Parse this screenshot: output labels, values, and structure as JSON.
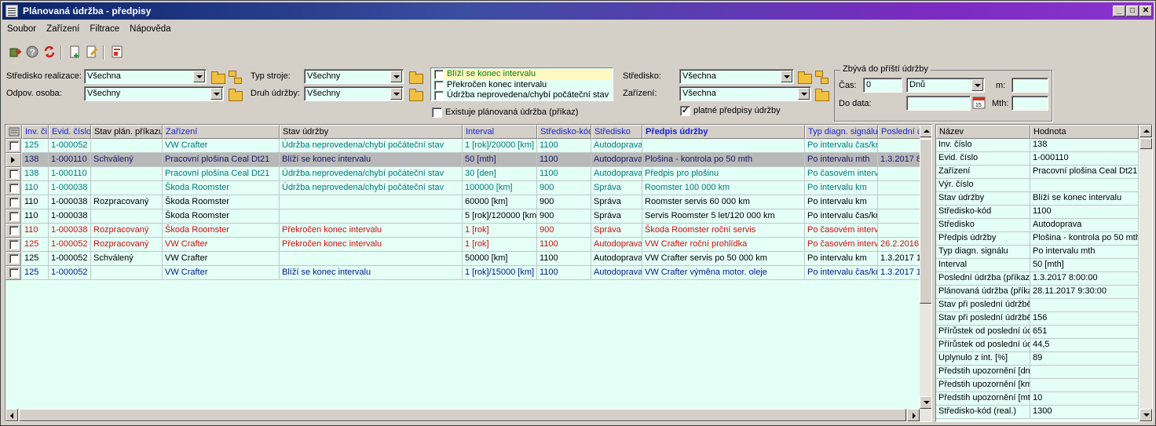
{
  "window": {
    "title": "Plánovaná údržba - předpisy"
  },
  "menu": [
    "Soubor",
    "Zařízení",
    "Filtrace",
    "Nápověda"
  ],
  "toolbar_icons": [
    "exit-icon",
    "help-icon",
    "refresh-icon",
    "new-doc-icon",
    "edit-doc-icon",
    "report-icon"
  ],
  "filters": {
    "stredisko_realizace": {
      "label": "Středisko realizace:",
      "value": "Všechna"
    },
    "odpov_osoba": {
      "label": "Odpov. osoba:",
      "value": "Všechny"
    },
    "typ_stroje": {
      "label": "Typ stroje:",
      "value": "Všechny"
    },
    "druh_udrzby": {
      "label": "Druh údržby:",
      "value": "Všechny"
    },
    "status_list": [
      {
        "label": "Blíží se konec intervalu",
        "checked": false,
        "color": "#0a7a10"
      },
      {
        "label": "Překročen konec intervalu",
        "checked": false,
        "color": "#000000"
      },
      {
        "label": "Údržba neprovedena/chybí počáteční stav",
        "checked": false,
        "color": "#000000"
      }
    ],
    "existuje_label": "Existuje plánovaná údržba (příkaz)",
    "stredisko": {
      "label": "Středisko:",
      "value": "Všechna"
    },
    "zarizeni": {
      "label": "Zařízení:",
      "value": "Všechna"
    },
    "platne_label": "platné předpisy údržby",
    "zbyva": {
      "title": "Zbývá do příští údržby",
      "cas_label": "Čas:",
      "cas_value": "0",
      "unit": "Dnů",
      "m_label": "m:",
      "do_data_label": "Do data:",
      "mth_label": "Mth:"
    }
  },
  "grid": {
    "columns": [
      "Inv. či",
      "Evid. číslo",
      "Stav plán. příkazu",
      "Zařízení",
      "Stav údržby",
      "Interval",
      "Středisko-kód",
      "Středisko",
      "Předpis údržby",
      "Typ diagn. signálu",
      "Poslední úd"
    ],
    "rows": [
      {
        "style": "teal",
        "cells": [
          "125",
          "1-000052",
          "",
          "VW Crafter",
          "Údržba neprovedena/chybí počáteční stav",
          "1 [rok]/20000 [km]",
          "1100",
          "Autodoprava",
          "",
          "Po intervalu čas/km",
          ""
        ]
      },
      {
        "style": "sel",
        "cells": [
          "138",
          "1-000110",
          "Schválený",
          "Pracovní plošina Ceal Dt21",
          "Blíží se konec intervalu",
          "50 [mth]",
          "1100",
          "Autodoprava",
          "Plošina - kontrola po 50 mth",
          "Po intervalu mth",
          "1.3.2017 8"
        ]
      },
      {
        "style": "teal",
        "cells": [
          "138",
          "1-000110",
          "",
          "Pracovní plošina Ceal Dt21",
          "Údržba neprovedena/chybí počáteční stav",
          "30 [den]",
          "1100",
          "Autodoprava",
          "Předpis pro plošinu",
          "Po časovém interva",
          ""
        ]
      },
      {
        "style": "teal",
        "cells": [
          "110",
          "1-000038",
          "",
          "Škoda Roomster",
          "Údržba neprovedena/chybí počáteční stav",
          "100000 [km]",
          "900",
          "Správa",
          "Roomster 100 000 km",
          "Po intervalu km",
          ""
        ]
      },
      {
        "style": "black",
        "cells": [
          "110",
          "1-000038",
          "Rozpracovaný",
          "Škoda Roomster",
          "",
          "60000 [km]",
          "900",
          "Správa",
          "Roomster servis 60 000 km",
          "Po intervalu km",
          ""
        ]
      },
      {
        "style": "black",
        "cells": [
          "110",
          "1-000038",
          "",
          "Škoda Roomster",
          "",
          "5 [rok]/120000 [km",
          "900",
          "Správa",
          "Servis Roomster 5 let/120 000 km",
          "Po intervalu čas/km",
          ""
        ]
      },
      {
        "style": "red",
        "cells": [
          "110",
          "1-000038",
          "Rozpracovaný",
          "Škoda Roomster",
          "Překročen konec intervalu",
          "1 [rok]",
          "900",
          "Správa",
          "Škoda Roomster roční servis",
          "Po časovém interva",
          ""
        ]
      },
      {
        "style": "red",
        "cells": [
          "125",
          "1-000052",
          "Rozpracovaný",
          "VW Crafter",
          "Překročen konec intervalu",
          "1 [rok]",
          "1100",
          "Autodoprava",
          "VW Crafter roční prohlídka",
          "Po časovém interva",
          "26.2.2016"
        ]
      },
      {
        "style": "black",
        "cells": [
          "125",
          "1-000052",
          "Schválený",
          "VW Crafter",
          "",
          "50000 [km]",
          "1100",
          "Autodoprava",
          "VW Crafter servis po 50 000 km",
          "Po intervalu km",
          "1.3.2017 1"
        ]
      },
      {
        "style": "navy",
        "cells": [
          "125",
          "1-000052",
          "",
          "VW Crafter",
          "Blíží se konec intervalu",
          "1 [rok]/15000 [km]",
          "1100",
          "Autodoprava",
          "VW Crafter výměna motor. oleje",
          "Po intervalu čas/km",
          "1.3.2017 1"
        ]
      }
    ]
  },
  "props": {
    "header": [
      "Název",
      "Hodnota"
    ],
    "rows": [
      [
        "Inv. číslo",
        "138"
      ],
      [
        "Evid. číslo",
        "1-000110"
      ],
      [
        "Zařízení",
        "Pracovní plošina Ceal Dt21"
      ],
      [
        "Výr. číslo",
        ""
      ],
      [
        "Stav údržby",
        "Blíží se konec intervalu"
      ],
      [
        "Středisko-kód",
        "1100"
      ],
      [
        "Středisko",
        "Autodoprava"
      ],
      [
        "Předpis údržby",
        "Plošina - kontrola po 50 mth"
      ],
      [
        "Typ diagn. signálu",
        "Po intervalu mth"
      ],
      [
        "Interval",
        "50 [mth]"
      ],
      [
        "Poslední údržba (příkaz)",
        "1.3.2017 8:00:00"
      ],
      [
        "Plánovaná údržba (příka",
        "28.11.2017 9:30:00"
      ],
      [
        "Stav při poslední údržbě",
        ""
      ],
      [
        "Stav při poslední údržbě",
        "156"
      ],
      [
        "Přírůstek od poslední údr",
        "651"
      ],
      [
        "Přírůstek od poslední údr",
        "44,5"
      ],
      [
        "Uplynulo z int. [%]",
        "89"
      ],
      [
        "Předstih upozornění [dn",
        ""
      ],
      [
        "Předstih upozornění [km",
        ""
      ],
      [
        "Předstih upozornění [mt",
        "10"
      ],
      [
        "Středisko-kód (real.)",
        "1300"
      ]
    ]
  }
}
